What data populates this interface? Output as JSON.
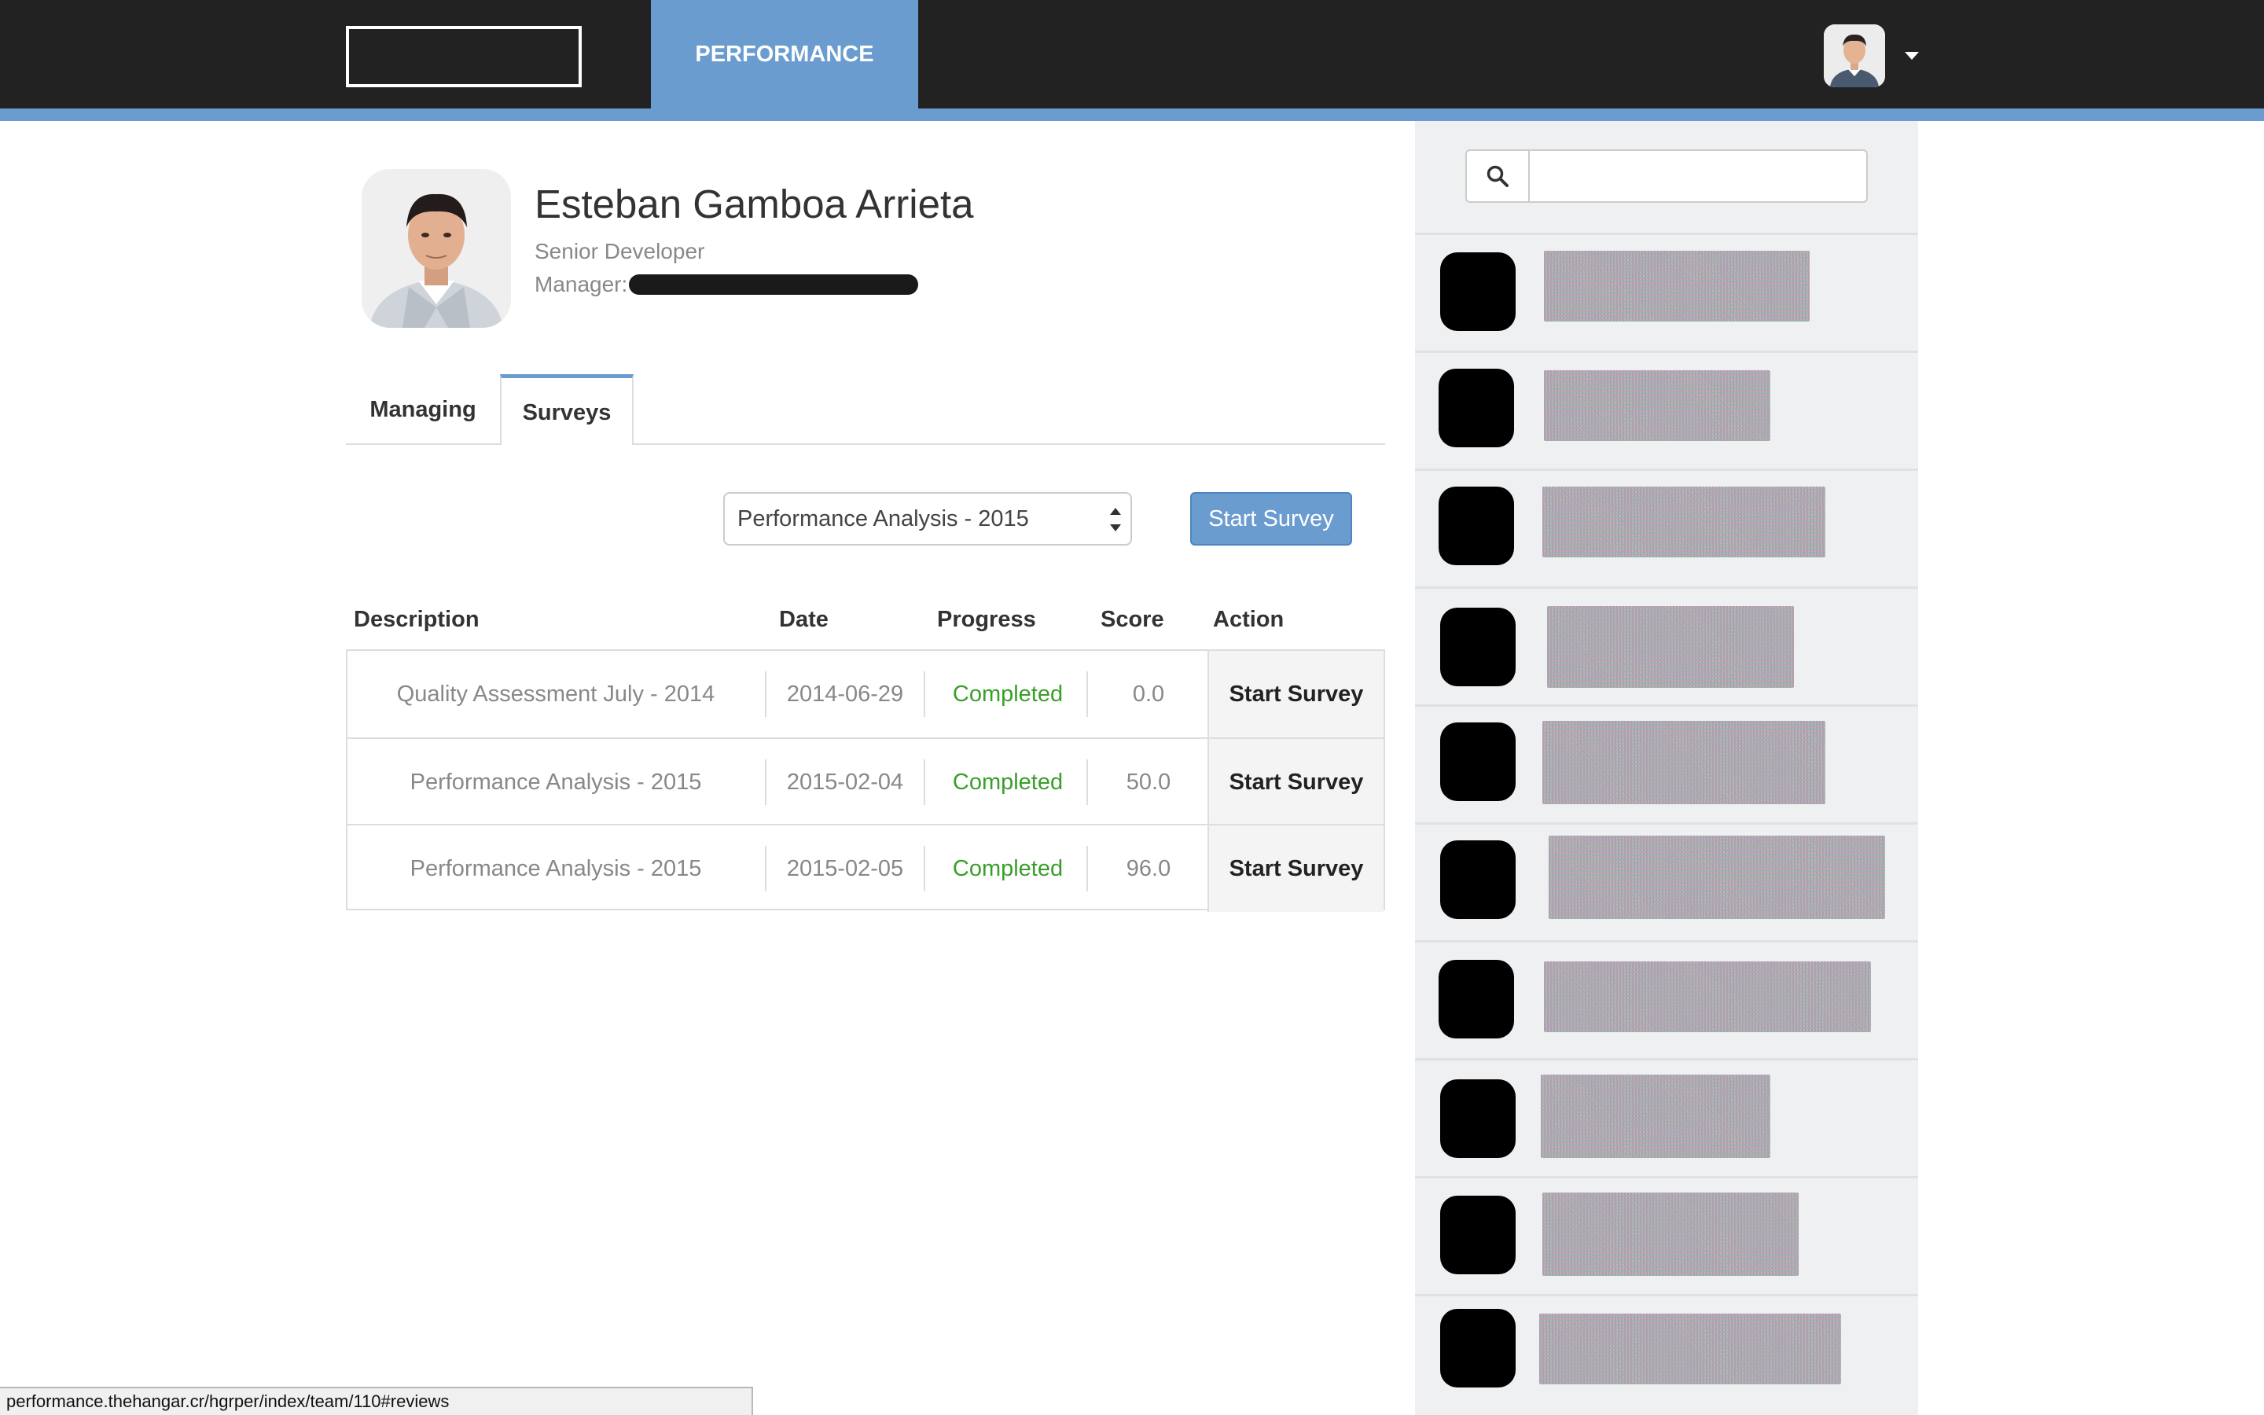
{
  "nav": {
    "active_tab": "PERFORMANCE"
  },
  "profile": {
    "name": "Esteban Gamboa Arrieta",
    "role": "Senior Developer",
    "manager_label": "Manager:"
  },
  "tabs": [
    {
      "label": "Managing",
      "active": false
    },
    {
      "label": "Surveys",
      "active": true
    }
  ],
  "survey_controls": {
    "selected_survey": "Performance Analysis - 2015",
    "start_button": "Start Survey"
  },
  "table": {
    "headers": [
      "Description",
      "Date",
      "Progress",
      "Score",
      "Action"
    ],
    "rows": [
      {
        "description": "Quality Assessment July - 2014",
        "date": "2014-06-29",
        "progress": "Completed",
        "score": "0.0",
        "action": "Start Survey"
      },
      {
        "description": "Performance Analysis - 2015",
        "date": "2015-02-04",
        "progress": "Completed",
        "score": "50.0",
        "action": "Start Survey"
      },
      {
        "description": "Performance Analysis - 2015",
        "date": "2015-02-05",
        "progress": "Completed",
        "score": "96.0",
        "action": "Start Survey"
      }
    ]
  },
  "sidebar": {
    "search_placeholder": ""
  },
  "status_bar": {
    "url": "performance.thehangar.cr/hgrper/index/team/110#reviews"
  },
  "colors": {
    "accent": "#6a9cd0",
    "topbar": "#222222",
    "completed": "#3a9e2a"
  }
}
